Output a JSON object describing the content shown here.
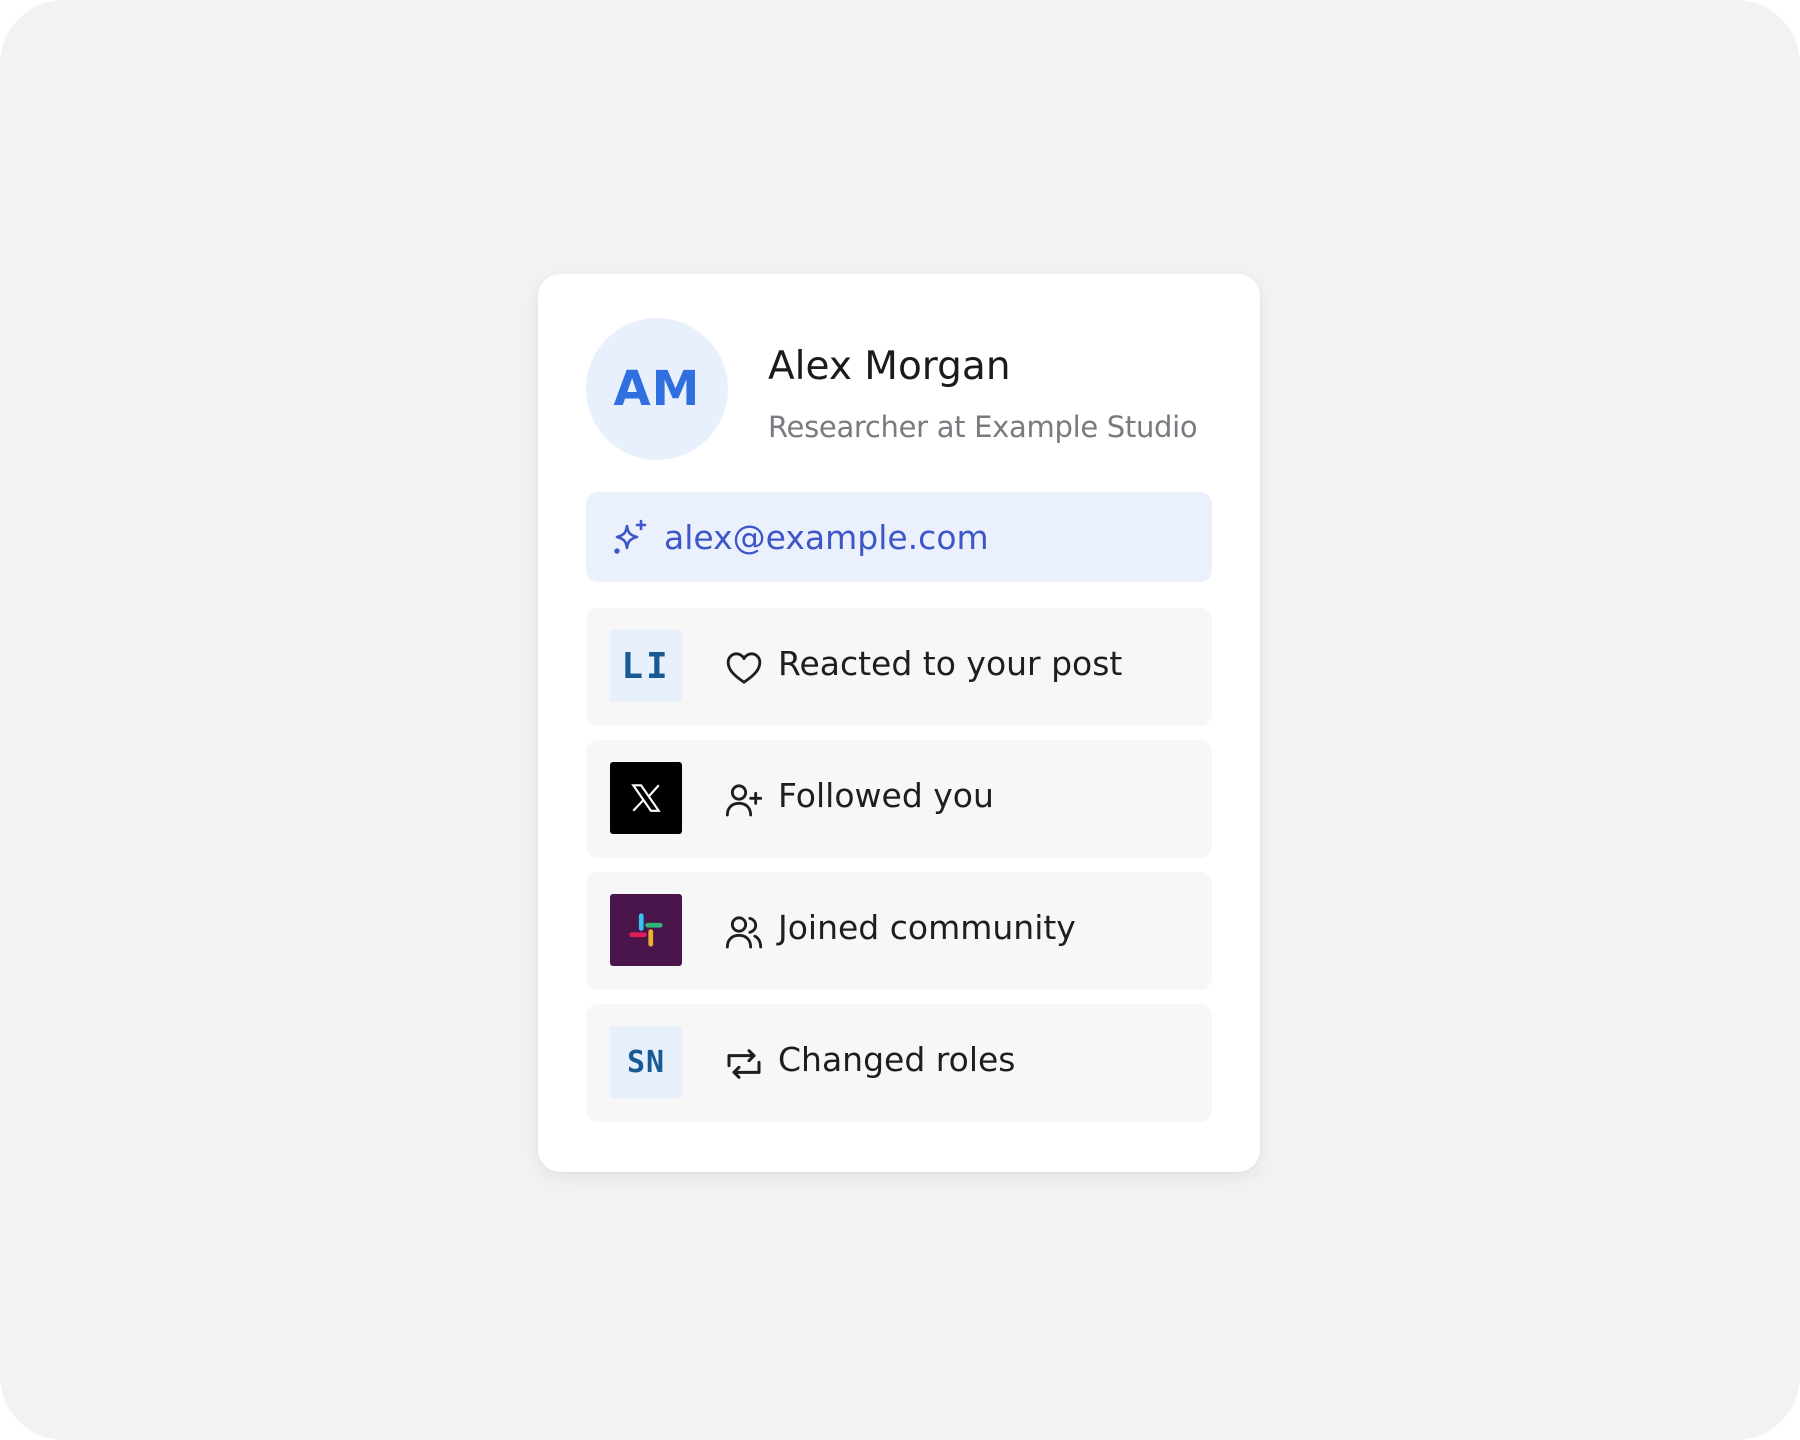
{
  "profile": {
    "initials": "AM",
    "name": "Alex Morgan",
    "role": "Researcher at Example Studio"
  },
  "email": {
    "address": "alex@example.com",
    "icon": "sparkle-icon"
  },
  "activities": [
    {
      "brand": "LinkedIn",
      "brand_text": "LI",
      "icon": "heart-icon",
      "label": "Reacted to your post"
    },
    {
      "brand": "X",
      "brand_text": "",
      "icon": "user-plus-icon",
      "label": "Followed you"
    },
    {
      "brand": "Slack",
      "brand_text": "",
      "icon": "users-icon",
      "label": "Joined community"
    },
    {
      "brand": "Sales Navigator",
      "brand_text": "SN",
      "icon": "repeat-icon",
      "label": "Changed roles"
    }
  ],
  "colors": {
    "background": "#f2f2f3",
    "card": "#ffffff",
    "avatar_bg": "#e9f0fd",
    "avatar_text": "#2f6fe0",
    "email_bg": "#eaf1fd",
    "email_text": "#3f56c9",
    "row_bg": "#f7f7f8",
    "linkedin_blue": "#175a95",
    "slack_purple": "#4a154b"
  }
}
